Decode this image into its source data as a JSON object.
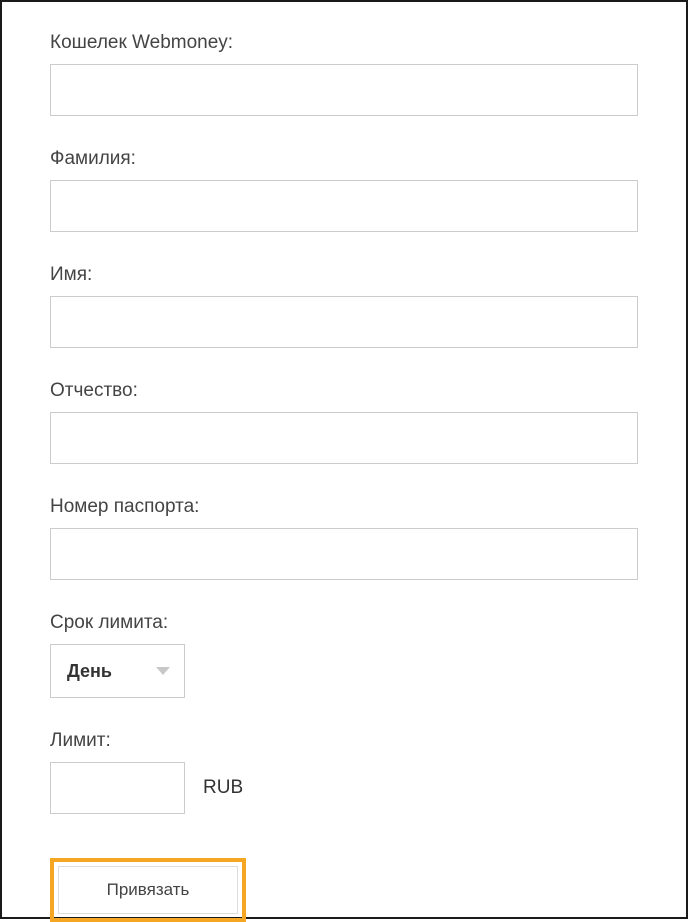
{
  "fields": {
    "wallet": {
      "label": "Кошелек Webmoney:",
      "value": ""
    },
    "surname": {
      "label": "Фамилия:",
      "value": ""
    },
    "name": {
      "label": "Имя:",
      "value": ""
    },
    "patronymic": {
      "label": "Отчество:",
      "value": ""
    },
    "passport": {
      "label": "Номер паспорта:",
      "value": ""
    },
    "limitPeriod": {
      "label": "Срок лимита:",
      "selected": "День"
    },
    "limit": {
      "label": "Лимит:",
      "value": "",
      "currency": "RUB"
    }
  },
  "actions": {
    "submit": "Привязать"
  }
}
